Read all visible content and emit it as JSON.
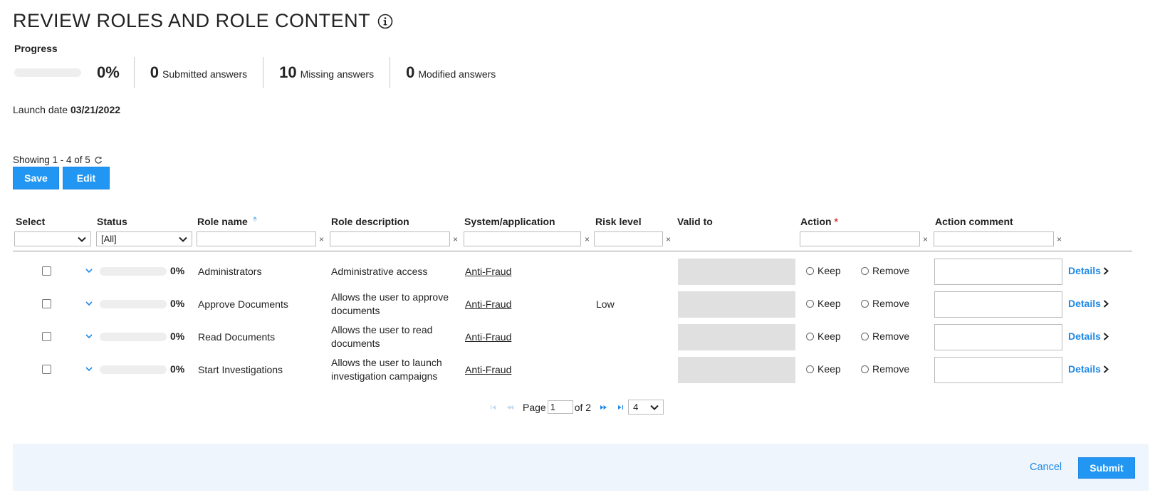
{
  "page": {
    "title": "REVIEW ROLES AND ROLE CONTENT",
    "info_icon": "info-icon"
  },
  "progress": {
    "label": "Progress",
    "percent_value": 0,
    "percent_text": "0%",
    "submitted_count": "0",
    "submitted_label": "Submitted answers",
    "missing_count": "10",
    "missing_label": "Missing answers",
    "modified_count": "0",
    "modified_label": "Modified answers"
  },
  "launch": {
    "label": "Launch date",
    "date": "03/21/2022"
  },
  "listing": {
    "showing_text": "Showing 1 - 4 of 5",
    "refresh_icon": "refresh-icon"
  },
  "toolbar": {
    "save_label": "Save",
    "edit_label": "Edit"
  },
  "table": {
    "headers": {
      "select": "Select",
      "status": "Status",
      "role_name": "Role name",
      "role_description": "Role description",
      "system": "System/application",
      "risk": "Risk level",
      "valid_to": "Valid to",
      "action": "Action",
      "action_required": "*",
      "comment": "Action comment"
    },
    "filters": {
      "select_value": "",
      "status_value": "[All]",
      "clear_symbol": "×"
    },
    "rows": [
      {
        "percent": "0%",
        "progress_value": 0,
        "role_name": "Administrators",
        "desc_line1": "Administrative access",
        "desc_line2": "",
        "system": "Anti-Fraud",
        "risk": "",
        "keep_label": "Keep",
        "remove_label": "Remove",
        "details_label": "Details"
      },
      {
        "percent": "0%",
        "progress_value": 0,
        "role_name": "Approve Documents",
        "desc_line1": "Allows the user to approve",
        "desc_line2": "documents",
        "system": "Anti-Fraud",
        "risk": "Low",
        "keep_label": "Keep",
        "remove_label": "Remove",
        "details_label": "Details"
      },
      {
        "percent": "0%",
        "progress_value": 0,
        "role_name": "Read Documents",
        "desc_line1": "Allows the user to read",
        "desc_line2": "documents",
        "system": "Anti-Fraud",
        "risk": "",
        "keep_label": "Keep",
        "remove_label": "Remove",
        "details_label": "Details"
      },
      {
        "percent": "0%",
        "progress_value": 0,
        "role_name": "Start Investigations",
        "desc_line1": "Allows the user to launch",
        "desc_line2": "investigation campaigns",
        "system": "Anti-Fraud",
        "risk": "",
        "keep_label": "Keep",
        "remove_label": "Remove",
        "details_label": "Details"
      }
    ]
  },
  "pagination": {
    "page_label": "Page",
    "current_page": "1",
    "of_label": "of 2",
    "page_size": "4"
  },
  "footer": {
    "cancel_label": "Cancel",
    "submit_label": "Submit"
  },
  "colors": {
    "accent": "#2196f3",
    "link": "#1e88e5",
    "footer_bg": "#eef5fc",
    "required": "#e53935"
  }
}
